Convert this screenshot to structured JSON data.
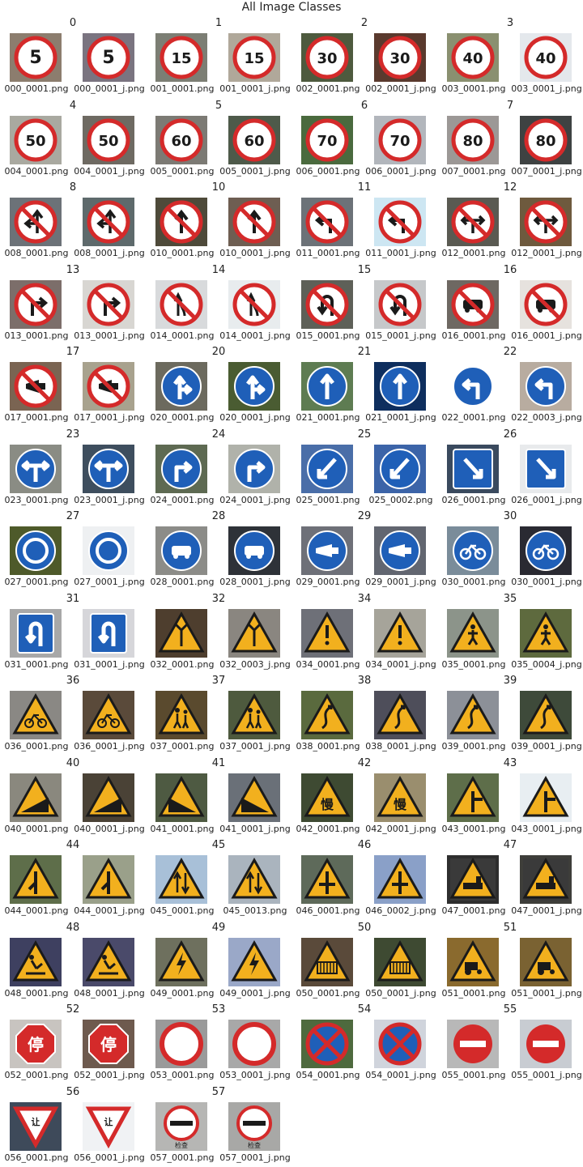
{
  "figure": {
    "title": "All Image Classes"
  },
  "classes": [
    {
      "label": "0",
      "images": [
        {
          "file": "000_0001.png",
          "icon": "speed-limit-5-sign",
          "bg": "#8c7d6e"
        },
        {
          "file": "000_0001_j.png",
          "icon": "speed-limit-5-sign",
          "bg": "#7a7480"
        }
      ]
    },
    {
      "label": "1",
      "images": [
        {
          "file": "001_0001.png",
          "icon": "speed-limit-15-sign",
          "bg": "#7c7e74"
        },
        {
          "file": "001_0001_j.png",
          "icon": "speed-limit-15-sign",
          "bg": "#b0a89a"
        }
      ]
    },
    {
      "label": "2",
      "images": [
        {
          "file": "002_0001.png",
          "icon": "speed-limit-30-sign",
          "bg": "#4e5a3e"
        },
        {
          "file": "002_0001_j.png",
          "icon": "speed-limit-30-sign",
          "bg": "#5a3a2e"
        }
      ]
    },
    {
      "label": "3",
      "images": [
        {
          "file": "003_0001.png",
          "icon": "speed-limit-40-sign",
          "bg": "#8a9070"
        },
        {
          "file": "003_0001_j.png",
          "icon": "speed-limit-40-sign",
          "bg": "#e4e8ec"
        }
      ]
    },
    {
      "label": "4",
      "images": [
        {
          "file": "004_0001.png",
          "icon": "speed-limit-50-sign",
          "bg": "#a9a9a0"
        },
        {
          "file": "004_0001_j.png",
          "icon": "speed-limit-50-sign",
          "bg": "#6e6a62"
        }
      ]
    },
    {
      "label": "5",
      "images": [
        {
          "file": "005_0001.png",
          "icon": "speed-limit-60-sign",
          "bg": "#7c7a74"
        },
        {
          "file": "005_0001_j.png",
          "icon": "speed-limit-60-sign",
          "bg": "#4e5a4a"
        }
      ]
    },
    {
      "label": "6",
      "images": [
        {
          "file": "006_0001.png",
          "icon": "speed-limit-70-sign",
          "bg": "#4a6a3e"
        },
        {
          "file": "006_0001_j.png",
          "icon": "speed-limit-70-sign",
          "bg": "#b2b6bc"
        }
      ]
    },
    {
      "label": "7",
      "images": [
        {
          "file": "007_0001.png",
          "icon": "speed-limit-80-sign",
          "bg": "#9c9896"
        },
        {
          "file": "007_0001_j.png",
          "icon": "speed-limit-80-sign",
          "bg": "#3e4242"
        }
      ]
    },
    {
      "label": "8",
      "images": [
        {
          "file": "008_0001.png",
          "icon": "no-left-straight-sign",
          "bg": "#6c7278"
        },
        {
          "file": "008_0001_j.png",
          "icon": "no-left-straight-sign",
          "bg": "#5e6a6c"
        }
      ]
    },
    {
      "label": "10",
      "images": [
        {
          "file": "010_0001.png",
          "icon": "no-straight-sign",
          "bg": "#4e4a3a"
        },
        {
          "file": "010_0001_j.png",
          "icon": "no-straight-sign",
          "bg": "#6e5e52"
        }
      ]
    },
    {
      "label": "11",
      "images": [
        {
          "file": "011_0001.png",
          "icon": "no-left-turn-sign",
          "bg": "#6c7278"
        },
        {
          "file": "011_0001_j.png",
          "icon": "no-left-turn-sign",
          "bg": "#cde6f2"
        }
      ]
    },
    {
      "label": "12",
      "images": [
        {
          "file": "012_0001.png",
          "icon": "no-left-right-sign",
          "bg": "#5a5a52"
        },
        {
          "file": "012_0001_j.png",
          "icon": "no-left-right-sign",
          "bg": "#6e5a3e"
        }
      ]
    },
    {
      "label": "13",
      "images": [
        {
          "file": "013_0001.png",
          "icon": "no-right-turn-sign",
          "bg": "#7c6e6a"
        },
        {
          "file": "013_0001_j.png",
          "icon": "no-right-turn-sign",
          "bg": "#d8d6d2"
        }
      ]
    },
    {
      "label": "14",
      "images": [
        {
          "file": "014_0001.png",
          "icon": "no-overtaking-sign",
          "bg": "#d8dadc"
        },
        {
          "file": "014_0001_j.png",
          "icon": "no-overtaking-sign",
          "bg": "#e8ecee"
        }
      ]
    },
    {
      "label": "15",
      "images": [
        {
          "file": "015_0001.png",
          "icon": "no-u-turn-sign",
          "bg": "#5e6058"
        },
        {
          "file": "015_0001_j.png",
          "icon": "no-u-turn-sign",
          "bg": "#c6c8ca"
        }
      ]
    },
    {
      "label": "16",
      "images": [
        {
          "file": "016_0001.png",
          "icon": "no-motor-vehicles-sign",
          "bg": "#6e6862"
        },
        {
          "file": "016_0001_j.png",
          "icon": "no-motor-vehicles-sign",
          "bg": "#e6e2de"
        }
      ]
    },
    {
      "label": "17",
      "images": [
        {
          "file": "017_0001.png",
          "icon": "no-honking-sign",
          "bg": "#7a6452"
        },
        {
          "file": "017_0001_j.png",
          "icon": "no-honking-sign",
          "bg": "#a8a28e"
        }
      ]
    },
    {
      "label": "20",
      "images": [
        {
          "file": "020_0001.png",
          "icon": "straight-or-right-sign",
          "bg": "#6c6a5e"
        },
        {
          "file": "020_0001_j.png",
          "icon": "straight-or-right-sign",
          "bg": "#4a5c32"
        }
      ]
    },
    {
      "label": "21",
      "images": [
        {
          "file": "021_0001.png",
          "icon": "straight-only-sign",
          "bg": "#5e7c52"
        },
        {
          "file": "021_0001_j.png",
          "icon": "straight-only-sign",
          "bg": "#0e2e5e"
        }
      ]
    },
    {
      "label": "22",
      "images": [
        {
          "file": "022_0001.png",
          "icon": "turn-left-sign",
          "bg": "#ffffff"
        },
        {
          "file": "022_0003_j.png",
          "icon": "turn-left-sign",
          "bg": "#b8aca0"
        }
      ]
    },
    {
      "label": "23",
      "images": [
        {
          "file": "023_0001.png",
          "icon": "left-or-right-sign",
          "bg": "#8a8c84"
        },
        {
          "file": "023_0001_j.png",
          "icon": "left-or-right-sign",
          "bg": "#3e4e5e"
        }
      ]
    },
    {
      "label": "24",
      "images": [
        {
          "file": "024_0001.png",
          "icon": "turn-right-sign",
          "bg": "#5e6a52"
        },
        {
          "file": "024_0001_j.png",
          "icon": "turn-right-sign",
          "bg": "#b0b2aa"
        }
      ]
    },
    {
      "label": "25",
      "images": [
        {
          "file": "025_0001.png",
          "icon": "keep-left-sign",
          "bg": "#4a6ea8"
        },
        {
          "file": "025_0002.png",
          "icon": "keep-left-sign",
          "bg": "#3c64a8"
        }
      ]
    },
    {
      "label": "26",
      "images": [
        {
          "file": "026_0001.png",
          "icon": "keep-right-sign",
          "bg": "#3a4a5e"
        },
        {
          "file": "026_0001_j.png",
          "icon": "keep-right-sign",
          "bg": "#e8eaec"
        }
      ]
    },
    {
      "label": "27",
      "images": [
        {
          "file": "027_0001.png",
          "icon": "roundabout-sign",
          "bg": "#4e5a2a"
        },
        {
          "file": "027_0001_j.png",
          "icon": "roundabout-sign",
          "bg": "#eef0f2"
        }
      ]
    },
    {
      "label": "28",
      "images": [
        {
          "file": "028_0001.png",
          "icon": "motor-vehicle-lane-sign",
          "bg": "#8c8c88"
        },
        {
          "file": "028_0001_j.png",
          "icon": "motor-vehicle-lane-sign",
          "bg": "#2e3238"
        }
      ]
    },
    {
      "label": "29",
      "images": [
        {
          "file": "029_0001.png",
          "icon": "horn-sign",
          "bg": "#6e7078"
        },
        {
          "file": "029_0001_j.png",
          "icon": "horn-sign",
          "bg": "#626670"
        }
      ]
    },
    {
      "label": "30",
      "images": [
        {
          "file": "030_0001.png",
          "icon": "bicycle-lane-sign",
          "bg": "#7a8c9a"
        },
        {
          "file": "030_0001_j.png",
          "icon": "bicycle-lane-sign",
          "bg": "#2a2a32"
        }
      ]
    },
    {
      "label": "31",
      "images": [
        {
          "file": "031_0001.png",
          "icon": "u-turn-sign",
          "bg": "#a8a8a8"
        },
        {
          "file": "031_0001_j.png",
          "icon": "u-turn-sign",
          "bg": "#d6d6da"
        }
      ]
    },
    {
      "label": "32",
      "images": [
        {
          "file": "032_0001.png",
          "icon": "warning-merge-sign",
          "bg": "#4e3e2e"
        },
        {
          "file": "032_0003_j.png",
          "icon": "warning-merge-sign",
          "bg": "#8a8680"
        }
      ]
    },
    {
      "label": "34",
      "images": [
        {
          "file": "034_0001.png",
          "icon": "warning-exclamation-sign",
          "bg": "#6e7078"
        },
        {
          "file": "034_0001_j.png",
          "icon": "warning-exclamation-sign",
          "bg": "#a6a49a"
        }
      ]
    },
    {
      "label": "35",
      "images": [
        {
          "file": "035_0001.png",
          "icon": "warning-pedestrian-sign",
          "bg": "#8c948a"
        },
        {
          "file": "035_0004_j.png",
          "icon": "warning-pedestrian-sign",
          "bg": "#5e6a3e"
        }
      ]
    },
    {
      "label": "36",
      "images": [
        {
          "file": "036_0001.png",
          "icon": "warning-bicycle-sign",
          "bg": "#8a8884"
        },
        {
          "file": "036_0001_j.png",
          "icon": "warning-bicycle-sign",
          "bg": "#5a4a3a"
        }
      ]
    },
    {
      "label": "37",
      "images": [
        {
          "file": "037_0001.png",
          "icon": "warning-children-sign",
          "bg": "#5a4a2e"
        },
        {
          "file": "037_0001_j.png",
          "icon": "warning-children-sign",
          "bg": "#4e5a3e"
        }
      ]
    },
    {
      "label": "38",
      "images": [
        {
          "file": "038_0001.png",
          "icon": "warning-winding-road-sign",
          "bg": "#5a6a3e"
        },
        {
          "file": "038_0001_j.png",
          "icon": "warning-winding-road-sign",
          "bg": "#4e4e5a"
        }
      ]
    },
    {
      "label": "39",
      "images": [
        {
          "file": "039_0001.png",
          "icon": "warning-winding-road-sign",
          "bg": "#8c9098"
        },
        {
          "file": "039_0001_j.png",
          "icon": "warning-winding-road-sign",
          "bg": "#3e4a3a"
        }
      ]
    },
    {
      "label": "40",
      "images": [
        {
          "file": "040_0001.png",
          "icon": "warning-steep-descent-sign",
          "bg": "#8a887e"
        },
        {
          "file": "040_0001_j.png",
          "icon": "warning-steep-descent-sign",
          "bg": "#4a4236"
        }
      ]
    },
    {
      "label": "41",
      "images": [
        {
          "file": "041_0001.png",
          "icon": "warning-steep-ascent-sign",
          "bg": "#4e5a42"
        },
        {
          "file": "041_0001_j.png",
          "icon": "warning-steep-ascent-sign",
          "bg": "#6a7078"
        }
      ]
    },
    {
      "label": "42",
      "images": [
        {
          "file": "042_0001.png",
          "icon": "warning-slow-sign",
          "bg": "#3e4a32"
        },
        {
          "file": "042_0001_j.png",
          "icon": "warning-slow-sign",
          "bg": "#9a8e6e"
        }
      ]
    },
    {
      "label": "43",
      "images": [
        {
          "file": "043_0001.png",
          "icon": "warning-t-junction-sign",
          "bg": "#5e6e4a"
        },
        {
          "file": "043_0001_j.png",
          "icon": "warning-t-junction-sign",
          "bg": "#e8eef2"
        }
      ]
    },
    {
      "label": "44",
      "images": [
        {
          "file": "044_0001.png",
          "icon": "warning-side-road-sign",
          "bg": "#5e6e4a"
        },
        {
          "file": "044_0001_j.png",
          "icon": "warning-side-road-sign",
          "bg": "#9aa08a"
        }
      ]
    },
    {
      "label": "45",
      "images": [
        {
          "file": "045_0001.png",
          "icon": "warning-two-way-sign",
          "bg": "#a8c0d8"
        },
        {
          "file": "045_0013.png",
          "icon": "warning-two-way-sign",
          "bg": "#aab4be"
        }
      ]
    },
    {
      "label": "46",
      "images": [
        {
          "file": "046_0001.png",
          "icon": "warning-crossroad-sign",
          "bg": "#5e6a5a"
        },
        {
          "file": "046_0002_j.png",
          "icon": "warning-crossroad-sign",
          "bg": "#8aa0c8"
        }
      ]
    },
    {
      "label": "47",
      "images": [
        {
          "file": "047_0001.png",
          "icon": "warning-railway-sign",
          "bg": "#2e2e2e"
        },
        {
          "file": "047_0001_j.png",
          "icon": "warning-railway-sign",
          "bg": "#3e3e3a"
        }
      ]
    },
    {
      "label": "48",
      "images": [
        {
          "file": "048_0001.png",
          "icon": "roadwork-sign",
          "bg": "#3e4060"
        },
        {
          "file": "048_0001_j.png",
          "icon": "roadwork-sign",
          "bg": "#4a4a6a"
        }
      ]
    },
    {
      "label": "49",
      "images": [
        {
          "file": "049_0001.png",
          "icon": "warning-lightning-sign",
          "bg": "#6e705e"
        },
        {
          "file": "049_0001_j.png",
          "icon": "warning-lightning-sign",
          "bg": "#9aa8c8"
        }
      ]
    },
    {
      "label": "50",
      "images": [
        {
          "file": "050_0001.png",
          "icon": "warning-gate-sign",
          "bg": "#5a4a3a"
        },
        {
          "file": "050_0001_j.png",
          "icon": "warning-gate-sign",
          "bg": "#3e4a32"
        }
      ]
    },
    {
      "label": "51",
      "images": [
        {
          "file": "051_0001.png",
          "icon": "warning-tractor-sign",
          "bg": "#8a6a2e"
        },
        {
          "file": "051_0001_j.png",
          "icon": "warning-tractor-sign",
          "bg": "#7a6232"
        }
      ]
    },
    {
      "label": "52",
      "images": [
        {
          "file": "052_0001.png",
          "icon": "stop-sign",
          "bg": "#c8c4c0"
        },
        {
          "file": "052_0001_j.png",
          "icon": "stop-sign",
          "bg": "#6e5a4e"
        }
      ]
    },
    {
      "label": "53",
      "images": [
        {
          "file": "053_0001.png",
          "icon": "no-entry-vehicles-sign",
          "bg": "#9a9a9a"
        },
        {
          "file": "053_0001_j.png",
          "icon": "no-entry-vehicles-sign",
          "bg": "#a8a8a8"
        }
      ]
    },
    {
      "label": "54",
      "images": [
        {
          "file": "054_0001.png",
          "icon": "no-parking-sign",
          "bg": "#4e6a3e"
        },
        {
          "file": "054_0001_j.png",
          "icon": "no-parking-sign",
          "bg": "#d0d4dc"
        }
      ]
    },
    {
      "label": "55",
      "images": [
        {
          "file": "055_0001.png",
          "icon": "no-entry-sign",
          "bg": "#b8b8b8"
        },
        {
          "file": "055_0001_j.png",
          "icon": "no-entry-sign",
          "bg": "#c8ccd2"
        }
      ]
    },
    {
      "label": "56",
      "images": [
        {
          "file": "056_0001.png",
          "icon": "yield-sign",
          "bg": "#3e4a5a"
        },
        {
          "file": "056_0001_j.png",
          "icon": "yield-sign",
          "bg": "#f0f2f4"
        }
      ]
    },
    {
      "label": "57",
      "images": [
        {
          "file": "057_0001.png",
          "icon": "checkpoint-sign",
          "bg": "#b6b6b4"
        },
        {
          "file": "057_0001_j.png",
          "icon": "checkpoint-sign",
          "bg": "#a8a8a6"
        }
      ]
    }
  ],
  "sign_text": {
    "speed-limit-5-sign": "5",
    "speed-limit-15-sign": "15",
    "speed-limit-30-sign": "30",
    "speed-limit-40-sign": "40",
    "speed-limit-50-sign": "50",
    "speed-limit-60-sign": "60",
    "speed-limit-70-sign": "70",
    "speed-limit-80-sign": "80",
    "stop-sign": "停",
    "yield-sign": "让",
    "warning-slow-sign": "慢",
    "checkpoint-sign": "检查"
  },
  "colors": {
    "prohibit_red": "#d42a2a",
    "mandatory_blue": "#1f5fb8",
    "warning_yellow": "#f2b01e",
    "sign_white": "#ffffff",
    "ink_black": "#1a1a1a"
  }
}
